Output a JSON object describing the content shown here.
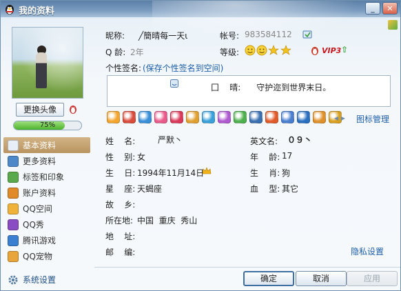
{
  "window": {
    "title": "我的资料"
  },
  "profile": {
    "nickname_label": "昵称:",
    "nickname_value": "╱簡晴每一天ι",
    "account_label": "帐号:",
    "account_value": "983584112",
    "age_label": "Q 龄:",
    "age_value": "2年",
    "level_label": "等级:",
    "vip_text": "VIP3",
    "signature_label": "个性签名:",
    "signature_link": "(保存个性签名到空间)",
    "signature_text": "囗    晴:      守护迩到世界末日。"
  },
  "left": {
    "change_avatar_label": "更换头像",
    "progress_text": "75%",
    "progress_fraction": 0.75,
    "nav": [
      {
        "label": "基本资料",
        "icon": "id-card-icon",
        "color": "#e8eef6"
      },
      {
        "label": "更多资料",
        "icon": "document-icon",
        "color": "#4d88c8"
      },
      {
        "label": "标签和印象",
        "icon": "tag-icon",
        "color": "#5aa94a"
      },
      {
        "label": "账户资料",
        "icon": "account-icon",
        "color": "#e08a2a"
      },
      {
        "label": "QQ空间",
        "icon": "qzone-icon",
        "color": "#f0b33a"
      },
      {
        "label": "QQ秀",
        "icon": "qqshow-icon",
        "color": "#8a4cc2"
      },
      {
        "label": "腾讯游戏",
        "icon": "game-icon",
        "color": "#3b7fd1"
      },
      {
        "label": "QQ宠物",
        "icon": "pet-icon",
        "color": "#e7a53a"
      }
    ],
    "settings_label": "系统设置"
  },
  "icon_bar": {
    "colors": [
      "#f3a52e",
      "#d94b3a",
      "#3a8fd9",
      "#e85a8a",
      "#d93a5a",
      "#e0a030",
      "#3aa0d9",
      "#b05ad0",
      "#4cb04c",
      "#3a6fb0",
      "#e05a2a",
      "#4a7fd0",
      "#2a6fc0",
      "#e0902a",
      "#d9a020"
    ],
    "manage_label": "图标管理"
  },
  "details": {
    "name_label": "姓    名:",
    "name_value": "严默丶",
    "english_label": "英文名:",
    "english_value": "０９丶",
    "gender_label": "性    别:",
    "gender_value": "女",
    "age_label": "年    龄:",
    "age_value": "17",
    "birthday_label": "生    日:",
    "birthday_value": "1994年11月14日",
    "zodiac_label": "生    肖:",
    "zodiac_value": "狗",
    "constellation_label": "星    座:",
    "constellation_value": "天蝎座",
    "blood_label": "血    型:",
    "blood_value": "其它",
    "hometown_label": "故    乡:",
    "hometown_value": "",
    "location_label": "所在地:",
    "location_value": "中国  重庆  秀山",
    "address_label": "地    址:",
    "address_value": "",
    "zipcode_label": "邮    编:",
    "zipcode_value": "",
    "privacy_link": "隐私设置"
  },
  "buttons": {
    "ok": "确定",
    "cancel": "取消",
    "apply": "应用"
  }
}
